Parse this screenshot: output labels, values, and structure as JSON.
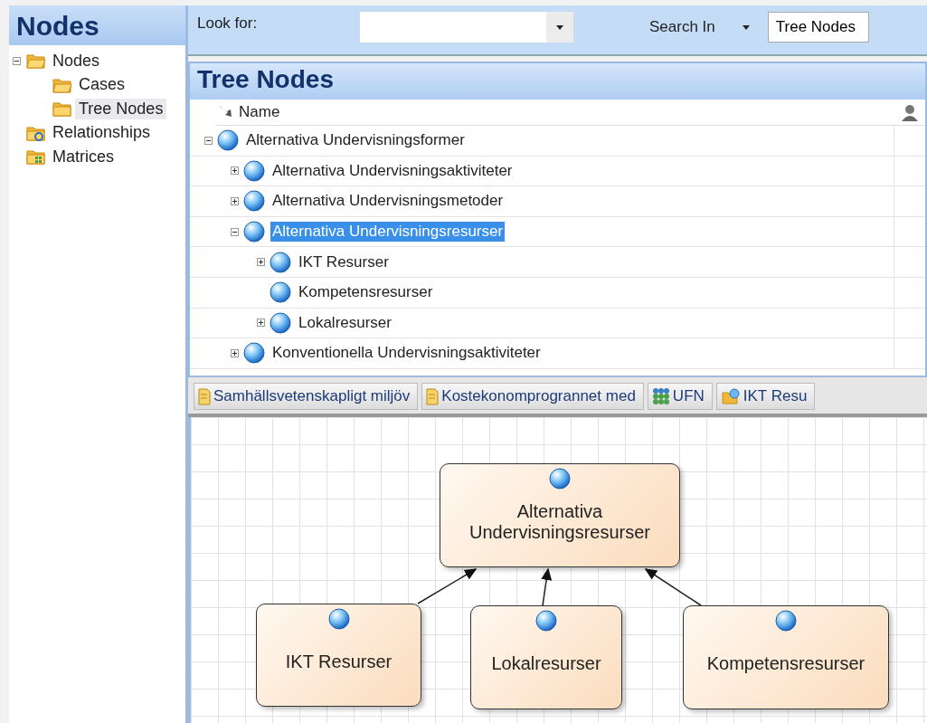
{
  "sidebar": {
    "title": "Nodes",
    "items": [
      {
        "label": "Nodes",
        "kind": "folder-open",
        "expanded": true,
        "selected": false,
        "children": [
          {
            "label": "Cases",
            "kind": "folder-open",
            "selected": false
          },
          {
            "label": "Tree Nodes",
            "kind": "folder",
            "selected": true
          }
        ]
      },
      {
        "label": "Relationships",
        "kind": "relationship-folder",
        "selected": false
      },
      {
        "label": "Matrices",
        "kind": "matrix-folder",
        "selected": false
      }
    ]
  },
  "toolbar": {
    "look_for_label": "Look for:",
    "search_in_label": "Search In",
    "search_in_value": "Tree Nodes"
  },
  "tree_panel": {
    "title": "Tree Nodes",
    "column": "Name",
    "rows": [
      {
        "label": "Alternativa Undervisningsformer",
        "expanded": true,
        "selected": false,
        "children": [
          {
            "label": "Alternativa Undervisningsaktiviteter",
            "expanded": false,
            "selected": false
          },
          {
            "label": "Alternativa Undervisningsmetoder",
            "expanded": false,
            "selected": false
          },
          {
            "label": "Alternativa Undervisningsresurser",
            "expanded": true,
            "selected": true,
            "children": [
              {
                "label": "IKT Resurser",
                "expanded": false,
                "selected": false
              },
              {
                "label": "Kompetensresurser",
                "selected": false
              },
              {
                "label": "Lokalresurser",
                "expanded": false,
                "selected": false
              }
            ]
          },
          {
            "label": "Konventionella Undervisningsaktiviteter",
            "expanded": false,
            "selected": false
          }
        ]
      }
    ]
  },
  "tabs": [
    {
      "label": "Samhällsvetenskapligt miljöv",
      "kind": "document",
      "selected": false
    },
    {
      "label": "Kostekonomprogrannet med",
      "kind": "document",
      "selected": false
    },
    {
      "label": "UFN",
      "kind": "matrix",
      "selected": false
    },
    {
      "label": "IKT Resu",
      "kind": "relationship",
      "selected": false
    }
  ],
  "diagram": {
    "nodes": [
      {
        "label": "Alternativa Undervisningsresurser"
      },
      {
        "label": "IKT Resurser"
      },
      {
        "label": "Lokalresurser"
      },
      {
        "label": "Kompetensresurser"
      }
    ]
  }
}
